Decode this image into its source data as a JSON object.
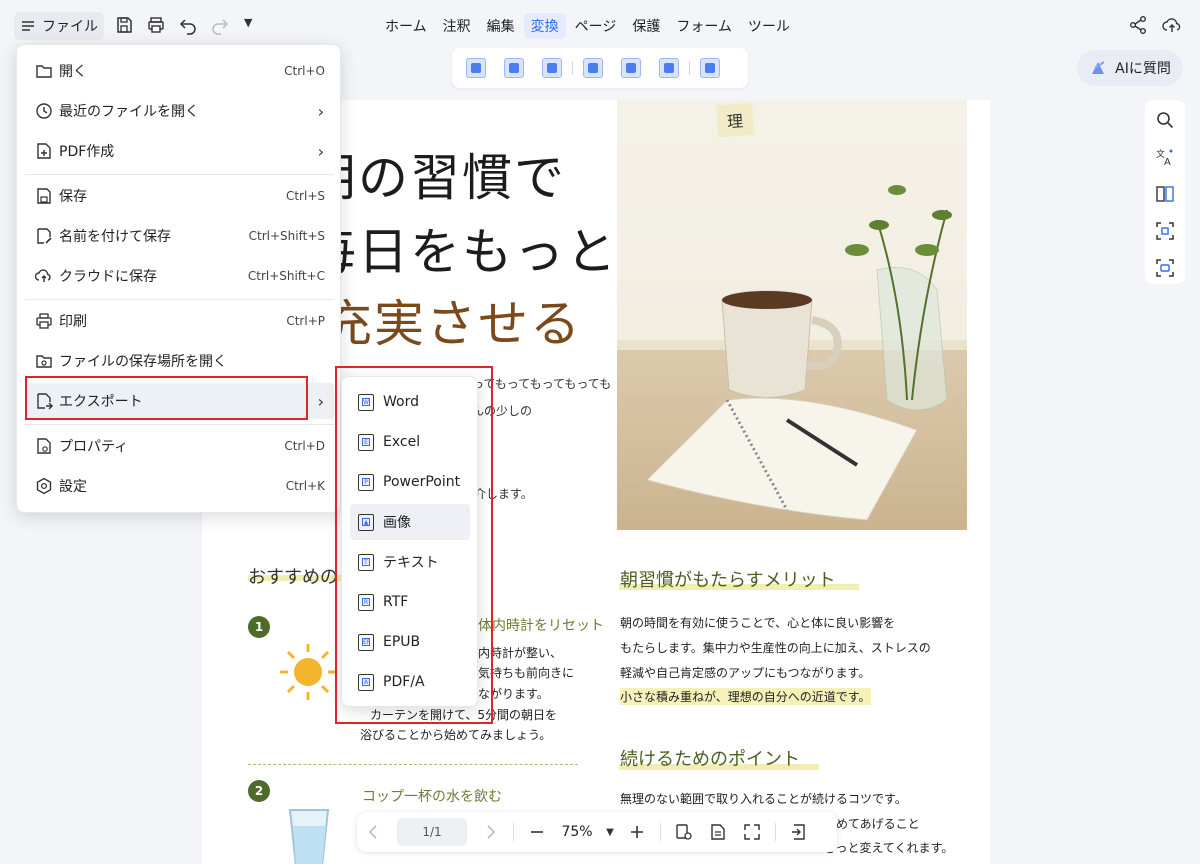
{
  "topbar": {
    "file_label": "ファイル",
    "tabs": [
      {
        "label": "ホーム",
        "active": false
      },
      {
        "label": "注釈",
        "active": false
      },
      {
        "label": "編集",
        "active": false
      },
      {
        "label": "変換",
        "active": true
      },
      {
        "label": "ページ",
        "active": false
      },
      {
        "label": "保護",
        "active": false
      },
      {
        "label": "フォーム",
        "active": false
      },
      {
        "label": "ツール",
        "active": false
      }
    ],
    "ai_label": "AIに質問"
  },
  "file_menu": {
    "items": [
      {
        "label": "開く",
        "shortcut": "Ctrl+O",
        "icon": "folder-open-icon"
      },
      {
        "label": "最近のファイルを開く",
        "icon": "clock-icon",
        "submenu": true
      },
      {
        "label": "PDF作成",
        "icon": "file-plus-icon",
        "submenu": true
      },
      {
        "label": "保存",
        "shortcut": "Ctrl+S",
        "icon": "save-icon"
      },
      {
        "label": "名前を付けて保存",
        "shortcut": "Ctrl+Shift+S",
        "icon": "save-as-icon"
      },
      {
        "label": "クラウドに保存",
        "shortcut": "Ctrl+Shift+C",
        "icon": "cloud-upload-icon"
      },
      {
        "label": "印刷",
        "shortcut": "Ctrl+P",
        "icon": "printer-icon"
      },
      {
        "label": "ファイルの保存場所を開く",
        "icon": "folder-search-icon"
      },
      {
        "label": "エクスポート",
        "icon": "export-icon",
        "submenu": true,
        "selected": true
      },
      {
        "label": "プロパティ",
        "shortcut": "Ctrl+D",
        "icon": "properties-icon"
      },
      {
        "label": "設定",
        "shortcut": "Ctrl+K",
        "icon": "settings-icon"
      }
    ]
  },
  "export_menu": {
    "items": [
      {
        "label": "Word",
        "glyph": "W"
      },
      {
        "label": "Excel",
        "glyph": "E"
      },
      {
        "label": "PowerPoint",
        "glyph": "P"
      },
      {
        "label": "画像",
        "glyph": "▲",
        "selected": true
      },
      {
        "label": "テキスト",
        "glyph": "T"
      },
      {
        "label": "RTF",
        "glyph": "R"
      },
      {
        "label": "EPUB",
        "glyph": "EP"
      },
      {
        "label": "PDF/A",
        "glyph": "A"
      }
    ]
  },
  "document": {
    "title_line1": "朝の習慣で",
    "title_line2": "毎日をもっと",
    "title_line3": "充実させる",
    "photo_tag": "理",
    "intro_lines": [
      "ってもってもってもっても",
      "んの少しの",
      "、",
      "介します。"
    ],
    "section_left_heading": "おすすめの",
    "item1_num": "1",
    "item1_heading": "体内時計をリセット",
    "item1_lines": [
      "内時計が整い、",
      "気持ちも前向きに",
      "ながります。",
      "カーテンを開けて、5分間の朝日を",
      "浴びることから始めてみましょう。"
    ],
    "item2_num": "2",
    "item2_heading": "コップ一杯の水を飲む",
    "benefit_heading": "朝習慣がもたらすメリット",
    "benefit_lines": [
      "朝の時間を有効に使うことで、心と体に良い影響を",
      "もたらします。集中力や生産性の向上に加え、ストレスの",
      "軽減や自己肯定感のアップにもつながります。",
      "小さな積み重ねが、理想の自分への近道です。"
    ],
    "tips_heading": "続けるためのポイント",
    "tips_lines": [
      "無理のない範囲で取り入れることが続けるコツです。",
      "褒めてあげること",
      "きっと変えてくれます。"
    ]
  },
  "bottombar": {
    "page_indicator": "1/1",
    "zoom": "75%"
  },
  "colors": {
    "accent": "#2f6cf5",
    "highlight_red": "#e0242a",
    "heading_green": "#4b5f24"
  }
}
